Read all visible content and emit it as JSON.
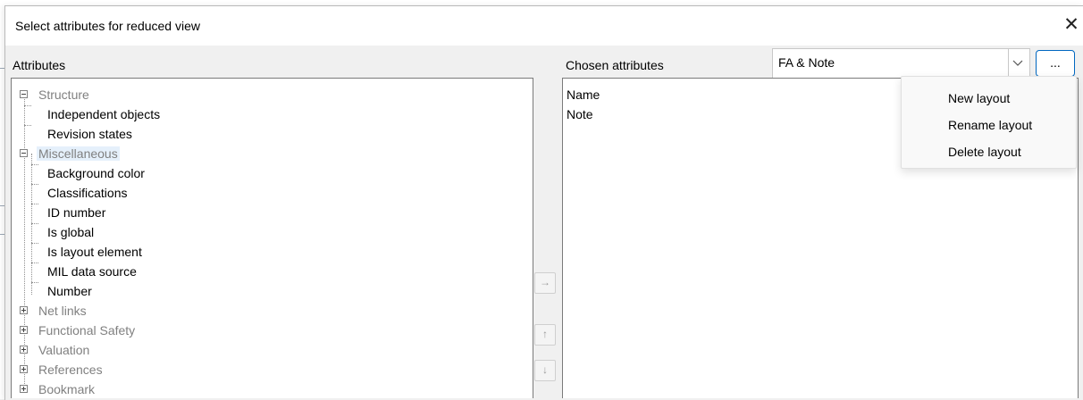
{
  "dialog": {
    "title": "Select attributes for reduced view",
    "close_glyph": "✕"
  },
  "attributes": {
    "label": "Attributes",
    "tree": [
      {
        "label": "Structure",
        "expanded": true,
        "children": [
          "Independent objects",
          "Revision states"
        ]
      },
      {
        "label": "Miscellaneous",
        "expanded": true,
        "selected": true,
        "children": [
          "Background color",
          "Classifications",
          "ID number",
          "Is global",
          "Is layout element",
          "MIL data source",
          "Number"
        ]
      },
      {
        "label": "Net links",
        "expanded": false
      },
      {
        "label": "Functional Safety",
        "expanded": false
      },
      {
        "label": "Valuation",
        "expanded": false
      },
      {
        "label": "References",
        "expanded": false
      },
      {
        "label": "Bookmark",
        "expanded": false
      }
    ]
  },
  "side_buttons": {
    "add": "→",
    "up": "↑",
    "down": "↓"
  },
  "chosen": {
    "label": "Chosen attributes",
    "items": [
      "Name",
      "Note"
    ]
  },
  "layout_combo": {
    "value": "FA & Note",
    "icon": "chevron-down-icon"
  },
  "layout_menu_button": {
    "label": "..."
  },
  "layout_menu": {
    "items": [
      "New layout",
      "Rename layout",
      "Delete layout"
    ]
  },
  "colors": {
    "accent": "#0067c0",
    "selection": "#e5f0fb",
    "category_text": "#808080"
  }
}
